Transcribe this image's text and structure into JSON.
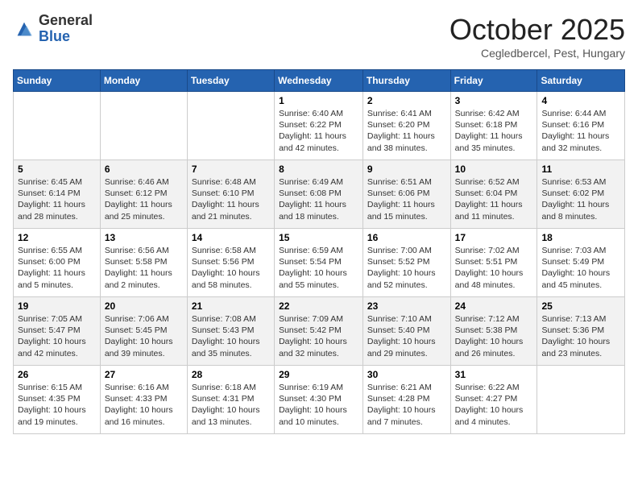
{
  "header": {
    "logo_general": "General",
    "logo_blue": "Blue",
    "month": "October 2025",
    "location": "Cegledbercel, Pest, Hungary"
  },
  "days_of_week": [
    "Sunday",
    "Monday",
    "Tuesday",
    "Wednesday",
    "Thursday",
    "Friday",
    "Saturday"
  ],
  "weeks": [
    [
      {
        "day": "",
        "info": ""
      },
      {
        "day": "",
        "info": ""
      },
      {
        "day": "",
        "info": ""
      },
      {
        "day": "1",
        "info": "Sunrise: 6:40 AM\nSunset: 6:22 PM\nDaylight: 11 hours and 42 minutes."
      },
      {
        "day": "2",
        "info": "Sunrise: 6:41 AM\nSunset: 6:20 PM\nDaylight: 11 hours and 38 minutes."
      },
      {
        "day": "3",
        "info": "Sunrise: 6:42 AM\nSunset: 6:18 PM\nDaylight: 11 hours and 35 minutes."
      },
      {
        "day": "4",
        "info": "Sunrise: 6:44 AM\nSunset: 6:16 PM\nDaylight: 11 hours and 32 minutes."
      }
    ],
    [
      {
        "day": "5",
        "info": "Sunrise: 6:45 AM\nSunset: 6:14 PM\nDaylight: 11 hours and 28 minutes."
      },
      {
        "day": "6",
        "info": "Sunrise: 6:46 AM\nSunset: 6:12 PM\nDaylight: 11 hours and 25 minutes."
      },
      {
        "day": "7",
        "info": "Sunrise: 6:48 AM\nSunset: 6:10 PM\nDaylight: 11 hours and 21 minutes."
      },
      {
        "day": "8",
        "info": "Sunrise: 6:49 AM\nSunset: 6:08 PM\nDaylight: 11 hours and 18 minutes."
      },
      {
        "day": "9",
        "info": "Sunrise: 6:51 AM\nSunset: 6:06 PM\nDaylight: 11 hours and 15 minutes."
      },
      {
        "day": "10",
        "info": "Sunrise: 6:52 AM\nSunset: 6:04 PM\nDaylight: 11 hours and 11 minutes."
      },
      {
        "day": "11",
        "info": "Sunrise: 6:53 AM\nSunset: 6:02 PM\nDaylight: 11 hours and 8 minutes."
      }
    ],
    [
      {
        "day": "12",
        "info": "Sunrise: 6:55 AM\nSunset: 6:00 PM\nDaylight: 11 hours and 5 minutes."
      },
      {
        "day": "13",
        "info": "Sunrise: 6:56 AM\nSunset: 5:58 PM\nDaylight: 11 hours and 2 minutes."
      },
      {
        "day": "14",
        "info": "Sunrise: 6:58 AM\nSunset: 5:56 PM\nDaylight: 10 hours and 58 minutes."
      },
      {
        "day": "15",
        "info": "Sunrise: 6:59 AM\nSunset: 5:54 PM\nDaylight: 10 hours and 55 minutes."
      },
      {
        "day": "16",
        "info": "Sunrise: 7:00 AM\nSunset: 5:52 PM\nDaylight: 10 hours and 52 minutes."
      },
      {
        "day": "17",
        "info": "Sunrise: 7:02 AM\nSunset: 5:51 PM\nDaylight: 10 hours and 48 minutes."
      },
      {
        "day": "18",
        "info": "Sunrise: 7:03 AM\nSunset: 5:49 PM\nDaylight: 10 hours and 45 minutes."
      }
    ],
    [
      {
        "day": "19",
        "info": "Sunrise: 7:05 AM\nSunset: 5:47 PM\nDaylight: 10 hours and 42 minutes."
      },
      {
        "day": "20",
        "info": "Sunrise: 7:06 AM\nSunset: 5:45 PM\nDaylight: 10 hours and 39 minutes."
      },
      {
        "day": "21",
        "info": "Sunrise: 7:08 AM\nSunset: 5:43 PM\nDaylight: 10 hours and 35 minutes."
      },
      {
        "day": "22",
        "info": "Sunrise: 7:09 AM\nSunset: 5:42 PM\nDaylight: 10 hours and 32 minutes."
      },
      {
        "day": "23",
        "info": "Sunrise: 7:10 AM\nSunset: 5:40 PM\nDaylight: 10 hours and 29 minutes."
      },
      {
        "day": "24",
        "info": "Sunrise: 7:12 AM\nSunset: 5:38 PM\nDaylight: 10 hours and 26 minutes."
      },
      {
        "day": "25",
        "info": "Sunrise: 7:13 AM\nSunset: 5:36 PM\nDaylight: 10 hours and 23 minutes."
      }
    ],
    [
      {
        "day": "26",
        "info": "Sunrise: 6:15 AM\nSunset: 4:35 PM\nDaylight: 10 hours and 19 minutes."
      },
      {
        "day": "27",
        "info": "Sunrise: 6:16 AM\nSunset: 4:33 PM\nDaylight: 10 hours and 16 minutes."
      },
      {
        "day": "28",
        "info": "Sunrise: 6:18 AM\nSunset: 4:31 PM\nDaylight: 10 hours and 13 minutes."
      },
      {
        "day": "29",
        "info": "Sunrise: 6:19 AM\nSunset: 4:30 PM\nDaylight: 10 hours and 10 minutes."
      },
      {
        "day": "30",
        "info": "Sunrise: 6:21 AM\nSunset: 4:28 PM\nDaylight: 10 hours and 7 minutes."
      },
      {
        "day": "31",
        "info": "Sunrise: 6:22 AM\nSunset: 4:27 PM\nDaylight: 10 hours and 4 minutes."
      },
      {
        "day": "",
        "info": ""
      }
    ]
  ]
}
